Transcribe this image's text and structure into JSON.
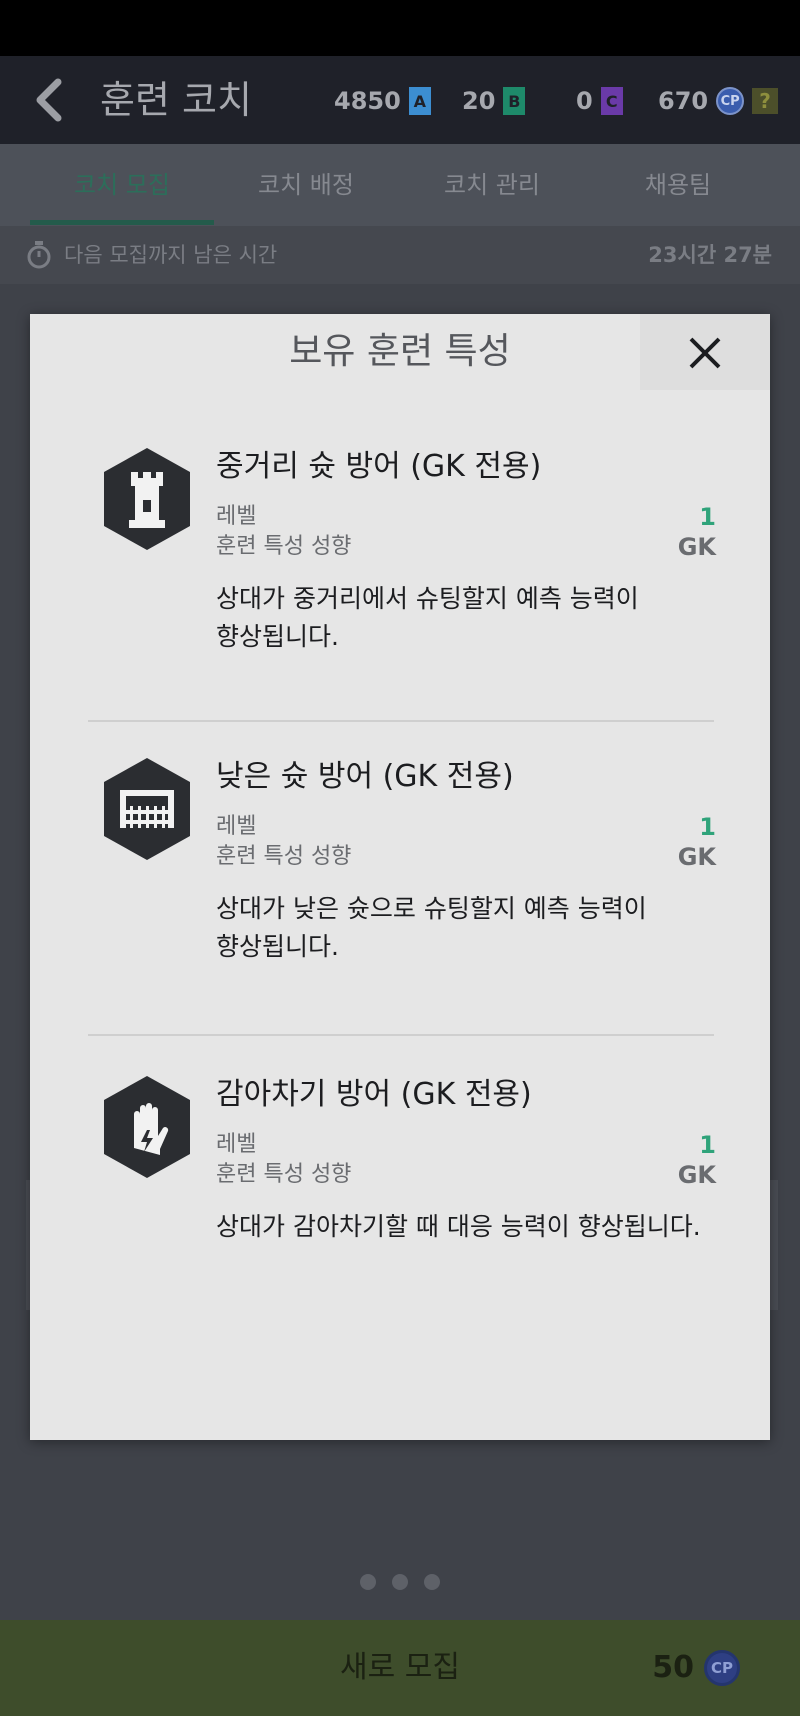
{
  "header": {
    "title": "훈련 코치",
    "currencies": [
      {
        "value": "4850",
        "badge": "A",
        "color": "#3c8ed1"
      },
      {
        "value": "20",
        "badge": "B",
        "color": "#1e8a6a"
      },
      {
        "value": "0",
        "badge": "C",
        "color": "#6a3aa8"
      }
    ],
    "cp_value": "670",
    "cp_label": "CP",
    "help_label": "?"
  },
  "tabs": [
    {
      "label": "코치 모집"
    },
    {
      "label": "코치 배정"
    },
    {
      "label": "코치 관리"
    },
    {
      "label": "채용팀"
    }
  ],
  "timer": {
    "label": "다음 모집까지 남은 시간",
    "value": "23시간 27분"
  },
  "modal": {
    "title": "보유 훈련 특성",
    "close_icon": "close-icon",
    "traits": [
      {
        "name": "중거리 슛 방어 (GK 전용)",
        "icon": "tower-icon",
        "level_label": "레벨",
        "level_value": "1",
        "position_label": "훈련 특성 성향",
        "position_value": "GK",
        "desc_line1": "상대가 중거리에서 슈팅할지 예측 능력이",
        "desc_line2": "향상됩니다."
      },
      {
        "name": "낮은 슛 방어 (GK 전용)",
        "icon": "goal-net-icon",
        "level_label": "레벨",
        "level_value": "1",
        "position_label": "훈련 특성 성향",
        "position_value": "GK",
        "desc_line1": "상대가 낮은 슛으로 슈팅할지 예측 능력이",
        "desc_line2": "향상됩니다."
      },
      {
        "name": "감아차기 방어 (GK 전용)",
        "icon": "glove-icon",
        "level_label": "레벨",
        "level_value": "1",
        "position_label": "훈련 특성 성향",
        "position_value": "GK",
        "desc_line1": "상대가 감아차기할 때 대응 능력이 향상됩니다.",
        "desc_line2": ""
      }
    ]
  },
  "footer": {
    "recruit_label": "새로 모집",
    "recruit_cost": "50",
    "recruit_coin": "CP"
  }
}
